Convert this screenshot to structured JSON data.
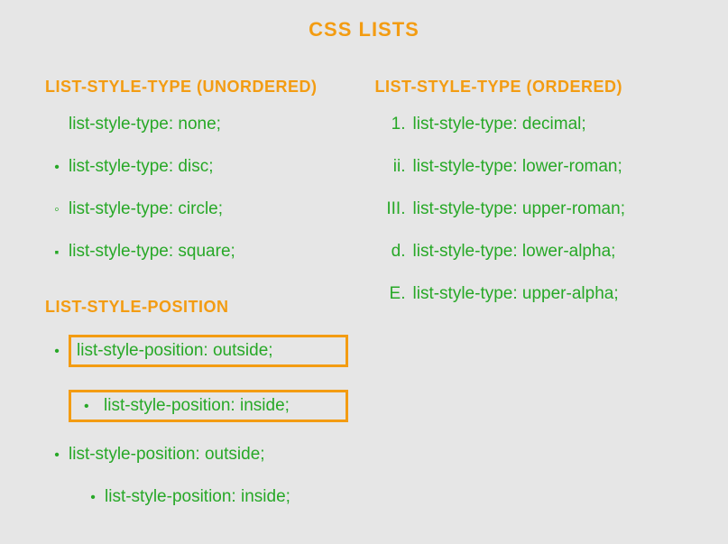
{
  "title": "CSS LISTS",
  "sections": {
    "unordered": {
      "heading": "LIST-STYLE-TYPE (UNORDERED)",
      "items": [
        {
          "marker": "",
          "text": "list-style-type: none;"
        },
        {
          "marker": "disc",
          "text": "list-style-type: disc;"
        },
        {
          "marker": "circle",
          "text": "list-style-type: circle;"
        },
        {
          "marker": "square",
          "text": "list-style-type: square;"
        }
      ]
    },
    "ordered": {
      "heading": "LIST-STYLE-TYPE (ORDERED)",
      "items": [
        {
          "marker": "1.",
          "text": "list-style-type: decimal;"
        },
        {
          "marker": "ii.",
          "text": "list-style-type: lower-roman;"
        },
        {
          "marker": "III.",
          "text": "list-style-type: upper-roman;"
        },
        {
          "marker": "d.",
          "text": "list-style-type: lower-alpha;"
        },
        {
          "marker": "E.",
          "text": "list-style-type: upper-alpha;"
        }
      ]
    },
    "position": {
      "heading": "LIST-STYLE-POSITION",
      "rows": [
        {
          "text": "list-style-position: outside;"
        },
        {
          "text": "list-style-position: inside;"
        },
        {
          "text": "list-style-position: outside;"
        },
        {
          "text": "list-style-position: inside;"
        }
      ]
    }
  }
}
